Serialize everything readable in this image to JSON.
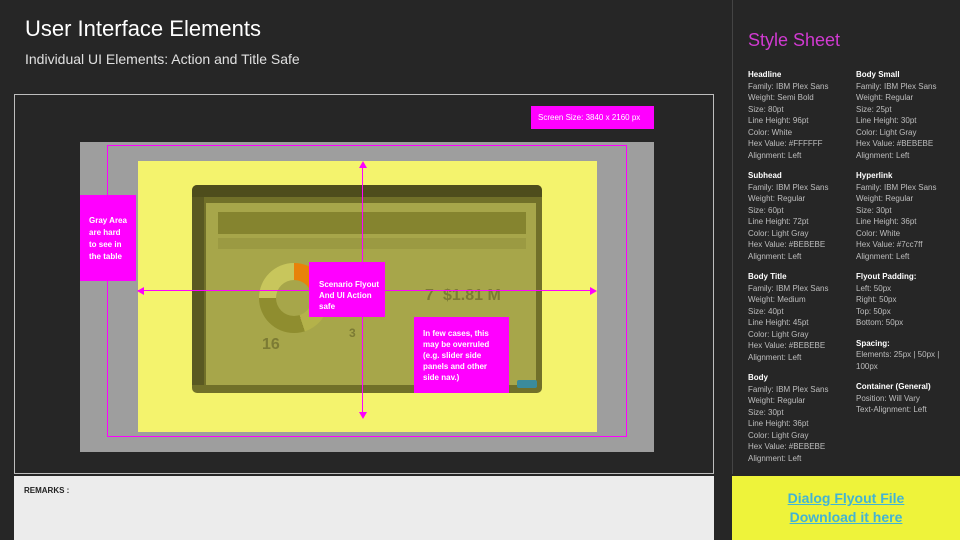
{
  "page": {
    "title": "User Interface Elements",
    "subtitle": "Individual UI Elements: Action and Title Safe"
  },
  "diagram": {
    "screen_size_label": "Screen Size: 3840 x 2160 px",
    "gray_area_note": "Gray Area\nare hard\nto see in\nthe table",
    "scenario_note": "Scenario Flyout\nAnd UI Action safe",
    "overruled_note": "In few  cases, this\nmay be overruled\n(e.g. slider side\npanels and other\nside nav.)",
    "mock_value_left": "16",
    "mock_value_mid": "3",
    "mock_value_right": "7",
    "mock_value_money": "$1.81 M"
  },
  "remarks": {
    "label": "REMARKS :"
  },
  "style_sheet": {
    "title": "Style Sheet",
    "left_column": [
      {
        "heading": "Headline",
        "lines": [
          "Family: IBM Plex Sans",
          "Weight: Semi Bold",
          "Size: 80pt",
          "Line Height: 96pt",
          "Color: White",
          "Hex Value: #FFFFFF",
          "Alignment: Left"
        ]
      },
      {
        "heading": "Subhead",
        "lines": [
          "Family: IBM Plex Sans",
          "Weight: Regular",
          "Size: 60pt",
          "Line Height: 72pt",
          "Color: Light Gray",
          "Hex Value: #BEBEBE",
          "Alignment: Left"
        ]
      },
      {
        "heading": "Body Title",
        "lines": [
          "Family: IBM Plex Sans",
          "Weight: Medium",
          "Size: 40pt",
          "Line Height: 45pt",
          "Color: Light Gray",
          "Hex Value: #BEBEBE",
          "Alignment: Left"
        ]
      },
      {
        "heading": "Body",
        "lines": [
          "Family: IBM Plex Sans",
          "Weight: Regular",
          "Size: 30pt",
          "Line Height: 36pt",
          "Color: Light Gray",
          "Hex Value: #BEBEBE",
          "Alignment: Left"
        ]
      }
    ],
    "right_column": [
      {
        "heading": "Body Small",
        "lines": [
          "Family: IBM Plex Sans",
          "Weight: Regular",
          "Size: 25pt",
          "Line Height: 30pt",
          "Color: Light Gray",
          "Hex Value: #BEBEBE",
          "Alignment: Left"
        ]
      },
      {
        "heading": "Hyperlink",
        "lines": [
          "Family: IBM Plex Sans",
          "Weight: Regular",
          "Size: 30pt",
          "Line Height: 36pt",
          "Color: White",
          "Hex Value: #7cc7ff",
          "Alignment: Left"
        ]
      },
      {
        "heading": "Flyout Padding:",
        "lines": [
          "Left: 50px",
          "Right: 50px",
          "Top: 50px",
          "Bottom: 50px"
        ]
      },
      {
        "heading": "Spacing:",
        "lines": [
          "Elements: 25px | 50px |",
          "100px"
        ]
      },
      {
        "heading": "Container (General)",
        "lines": [
          "Position: Will Vary",
          "Text-Alignment: Left"
        ]
      }
    ]
  },
  "download": {
    "line1": "Dialog Flyout File",
    "line2": "Download it here"
  },
  "colors": {
    "accent_magenta": "#ff00ff",
    "title_safe_yellow": "#f4f36d",
    "gray_area": "#9e9e9e",
    "download_bg": "#eef33a",
    "link": "#42b3d5"
  }
}
